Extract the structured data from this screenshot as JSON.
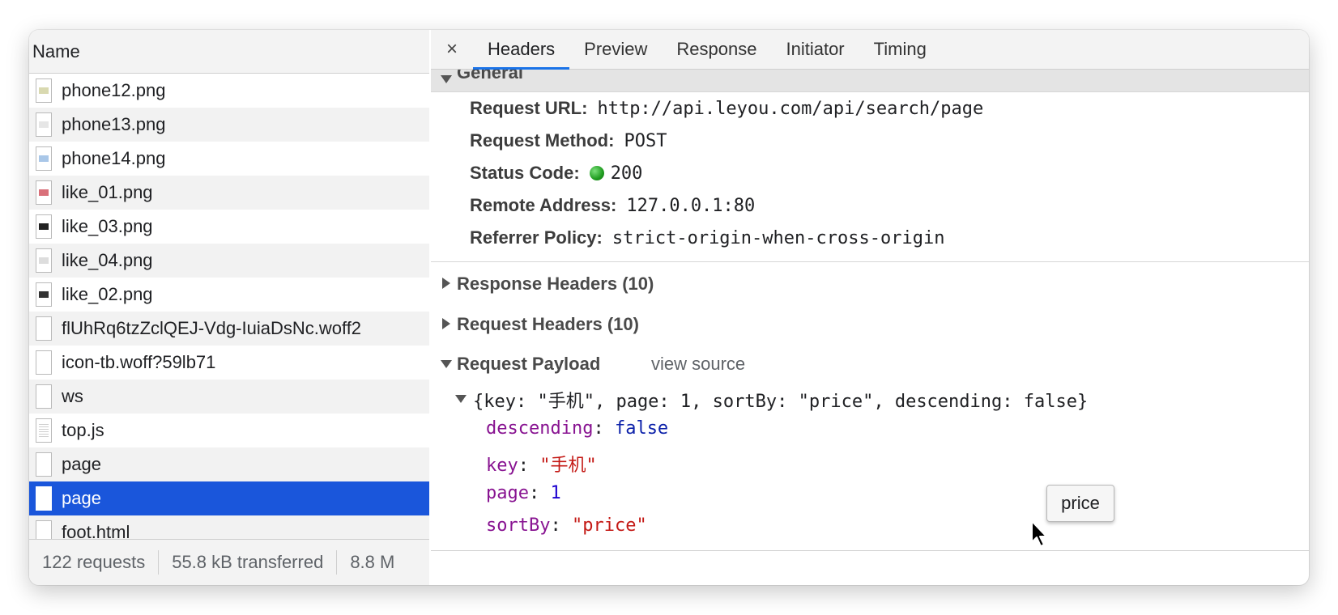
{
  "left_panel": {
    "column_header": "Name",
    "requests": [
      {
        "name": "phone12.png",
        "icon": "image-file-icon",
        "thumb": "#d9d9b0"
      },
      {
        "name": "phone13.png",
        "icon": "image-file-icon",
        "thumb": "#e6e6e6"
      },
      {
        "name": "phone14.png",
        "icon": "image-file-icon",
        "thumb": "#a9c7e8"
      },
      {
        "name": "like_01.png",
        "icon": "image-file-icon",
        "thumb": "#d9707a"
      },
      {
        "name": "like_03.png",
        "icon": "image-file-icon",
        "thumb": "#222222"
      },
      {
        "name": "like_04.png",
        "icon": "image-file-icon",
        "thumb": "#dddddd"
      },
      {
        "name": "like_02.png",
        "icon": "image-file-icon",
        "thumb": "#333333"
      },
      {
        "name": "flUhRq6tzZclQEJ-Vdg-IuiaDsNc.woff2",
        "icon": "blank-file-icon",
        "thumb": ""
      },
      {
        "name": "icon-tb.woff?59lb71",
        "icon": "blank-file-icon",
        "thumb": ""
      },
      {
        "name": "ws",
        "icon": "blank-file-icon",
        "thumb": ""
      },
      {
        "name": "top.js",
        "icon": "script-file-icon",
        "thumb": ""
      },
      {
        "name": "page",
        "icon": "blank-file-icon",
        "thumb": ""
      },
      {
        "name": "page",
        "icon": "blank-file-icon",
        "thumb": "",
        "selected": true
      },
      {
        "name": "foot.html",
        "icon": "blank-file-icon",
        "thumb": ""
      }
    ],
    "status_bar": {
      "requests": "122 requests",
      "transferred": "55.8 kB transferred",
      "resources": "8.8 M"
    }
  },
  "right_panel": {
    "close_glyph": "×",
    "tabs": [
      "Headers",
      "Preview",
      "Response",
      "Initiator",
      "Timing"
    ],
    "active_tab": "Headers",
    "general": {
      "title": "General",
      "fields": [
        {
          "key": "Request URL:",
          "value": "http://api.leyou.com/api/search/page"
        },
        {
          "key": "Request Method:",
          "value": "POST"
        },
        {
          "key": "Status Code:",
          "value": "200"
        },
        {
          "key": "Remote Address:",
          "value": "127.0.0.1:80"
        },
        {
          "key": "Referrer Policy:",
          "value": "strict-origin-when-cross-origin"
        }
      ]
    },
    "response_headers": "Response Headers (10)",
    "request_headers": "Request Headers (10)",
    "payload": {
      "title": "Request Payload",
      "view_source": "view source",
      "summary": "{key: \"手机\", page: 1, sortBy: \"price\", descending: false}",
      "props": [
        {
          "key": "descending",
          "sep": ": ",
          "value": "false",
          "type": "bool"
        },
        {
          "key": "key",
          "sep": ": ",
          "value": "\"手机\"",
          "type": "str"
        },
        {
          "key": "page",
          "sep": ": ",
          "value": "1",
          "type": "num"
        },
        {
          "key": "sortBy",
          "sep": ": ",
          "value": "\"price\"",
          "type": "str"
        }
      ]
    },
    "tooltip": "price",
    "status_color": "#1f9c1f",
    "accent_color": "#1a73e8",
    "selection_color": "#1a56db"
  }
}
